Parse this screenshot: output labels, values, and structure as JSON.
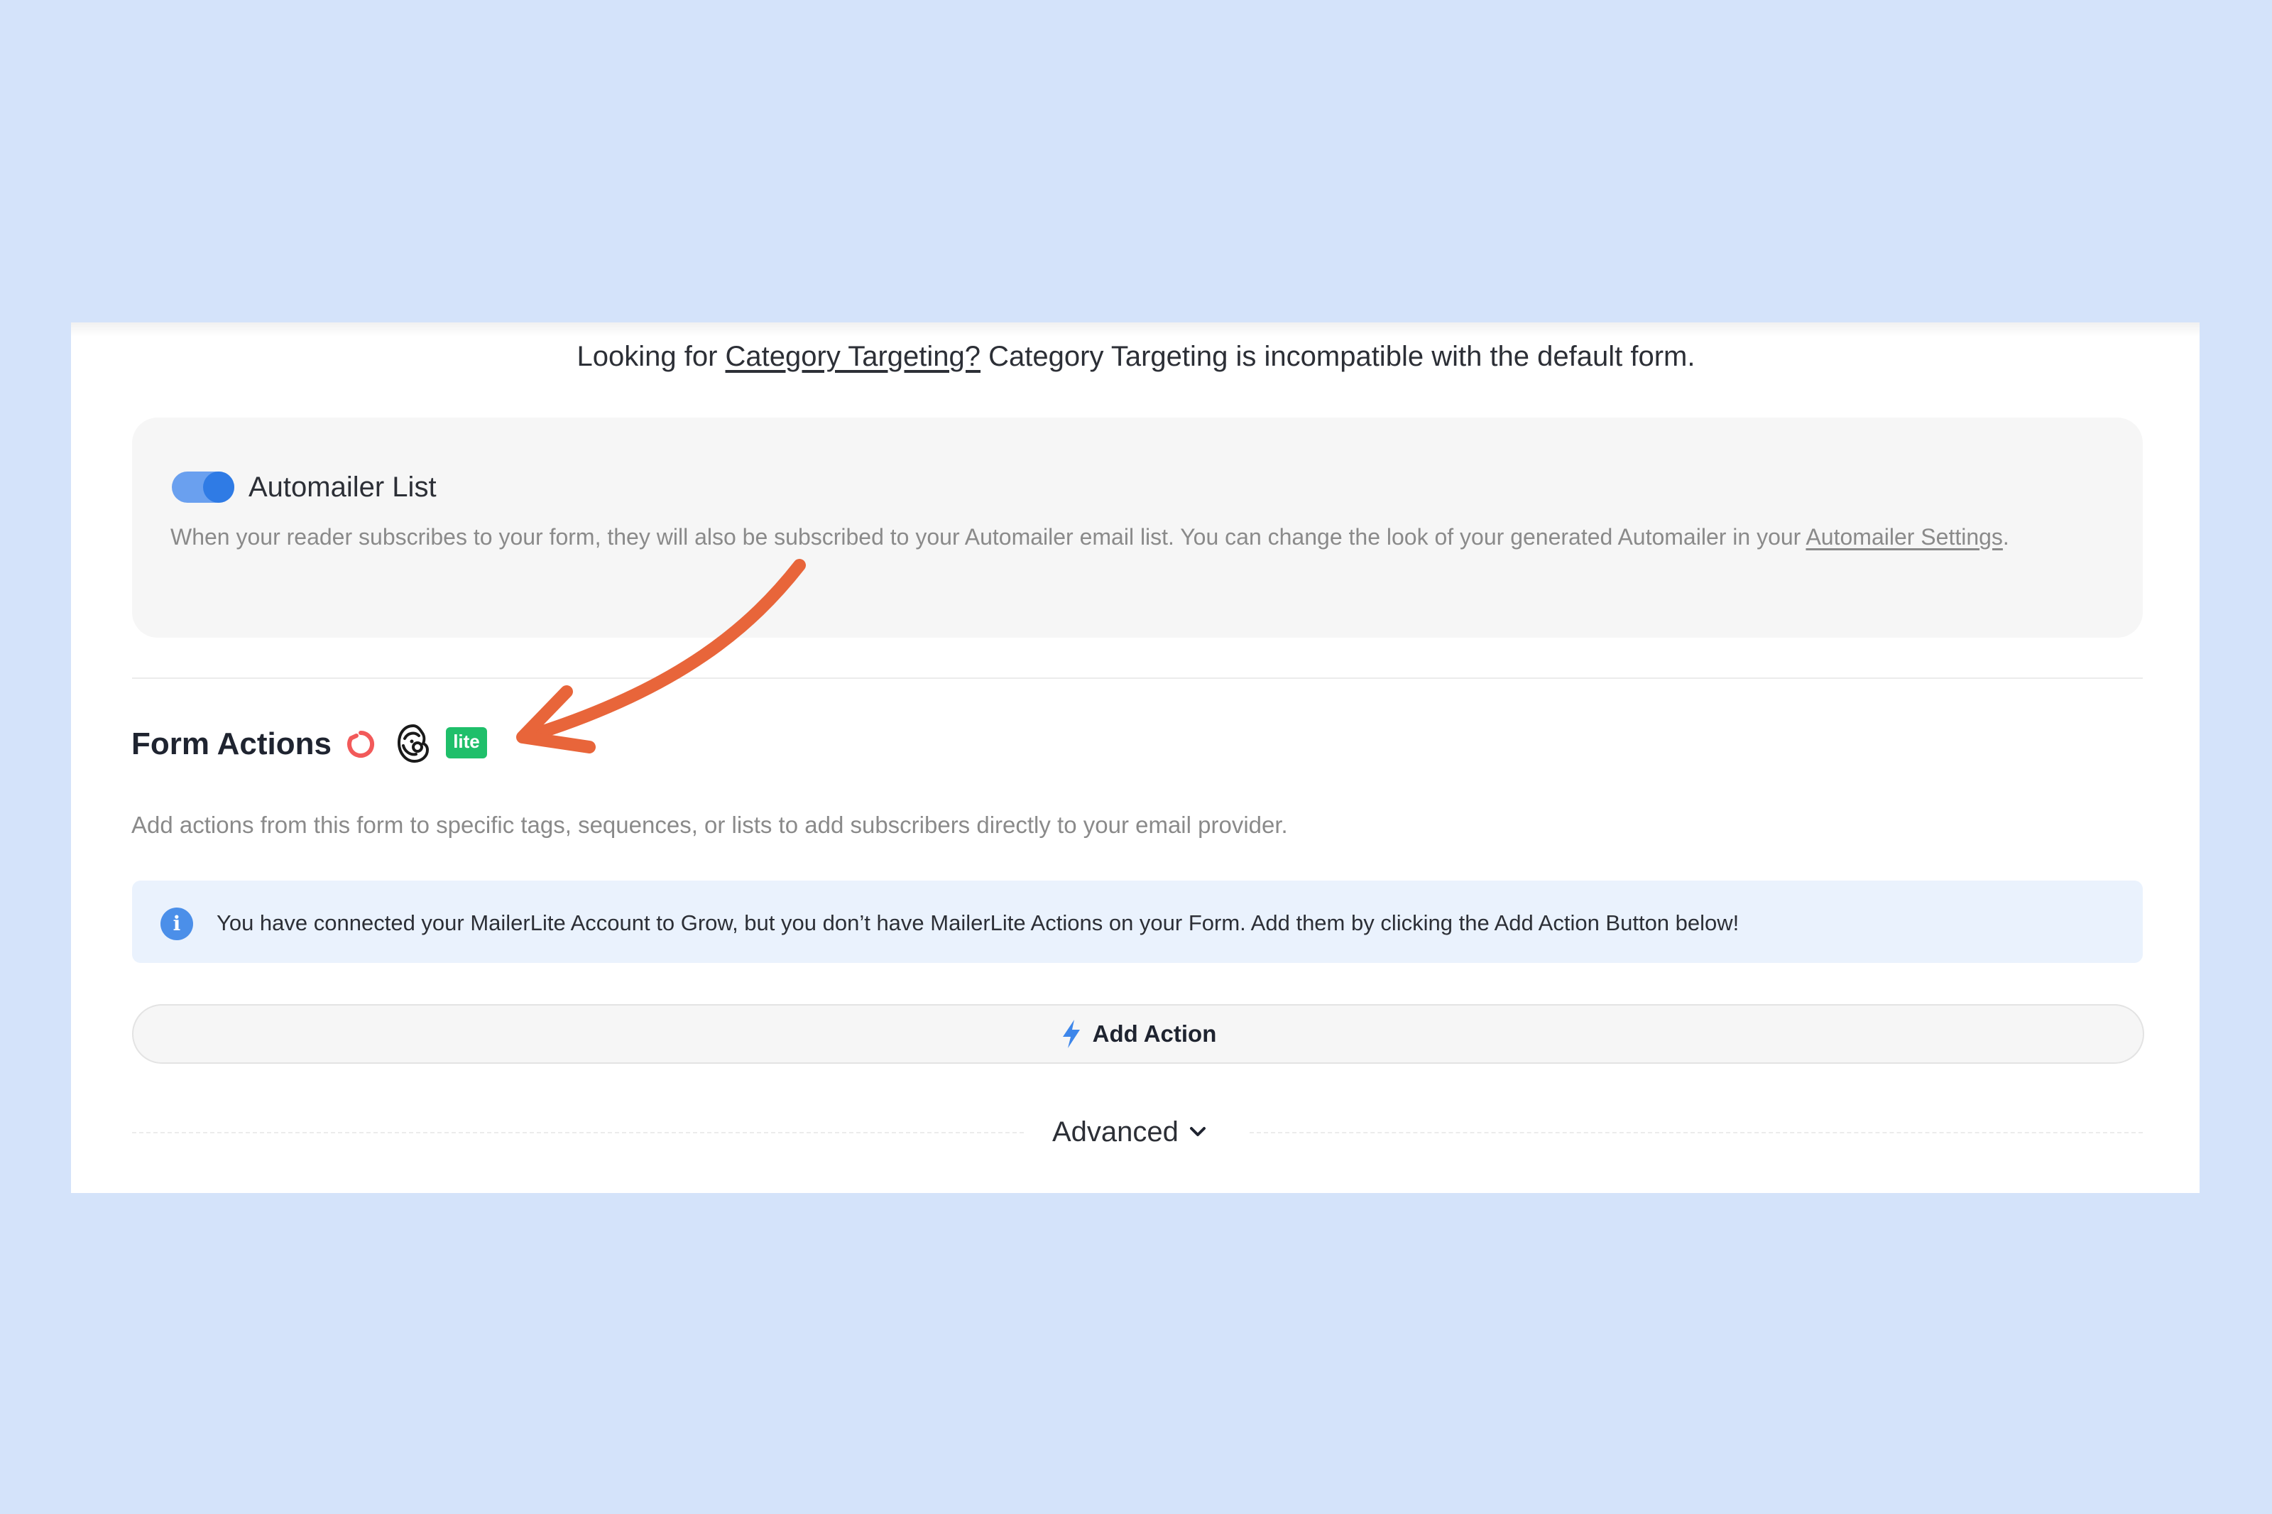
{
  "category_note": {
    "prefix": "Looking for ",
    "link": "Category Targeting?",
    "suffix": " Category Targeting is incompatible with the default form."
  },
  "automailer": {
    "title": "Automailer List",
    "toggle_on": true,
    "description_text": "When your reader subscribes to your form, they will also be subscribed to your Automailer email list. You can change the look of your generated Automailer in your ",
    "settings_link": "Automailer Settings",
    "description_end": "."
  },
  "form_actions": {
    "title": "Form Actions",
    "provider_icons": [
      "convertkit-icon",
      "mailchimp-icon",
      "mailerlite-icon"
    ],
    "mailerlite_label": "lite",
    "description": "Add actions from this form to specific tags, sequences, or lists to add subscribers directly to your email provider."
  },
  "info_banner": {
    "icon_glyph": "i",
    "text": "You have connected your MailerLite Account to Grow, but you don’t have MailerLite Actions on your Form. Add them by clicking the Add Action Button below!"
  },
  "add_action": {
    "label": "Add Action"
  },
  "advanced": {
    "label": "Advanced"
  },
  "colors": {
    "background": "#d4e3fa",
    "accent": "#2f7be5",
    "arrow": "#e8653a",
    "mailerlite": "#1fbf6a"
  }
}
